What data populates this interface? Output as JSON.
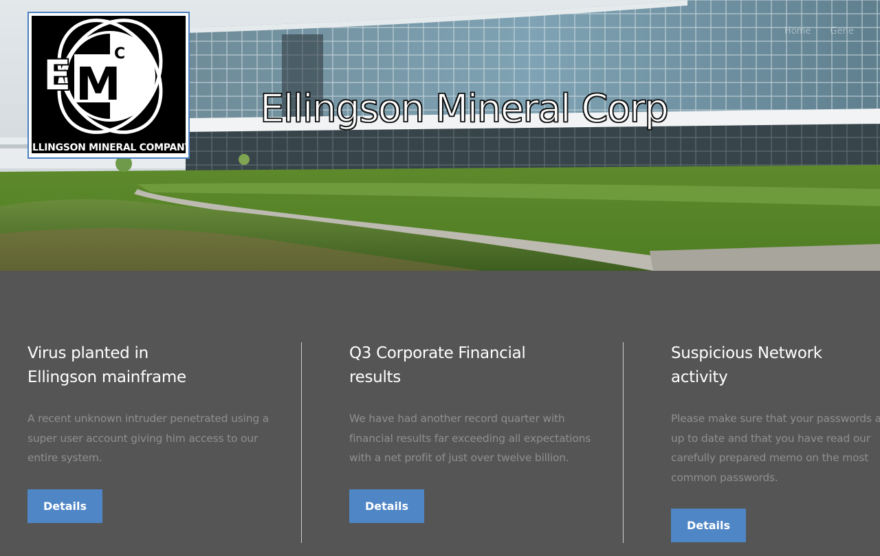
{
  "logo": {
    "letters_e": "E",
    "letters_m": "M",
    "letters_c": "C",
    "company_name": "ELLINGSON MINERAL COMPANY"
  },
  "nav": {
    "items": [
      {
        "label": "Home"
      },
      {
        "label": "Gene"
      }
    ]
  },
  "site_title": "Ellingson Mineral Corp",
  "columns": [
    {
      "title_line1": "Virus planted in",
      "title_line2": "Ellingson mainframe",
      "body": "A recent unknown intruder penetrated using a super user account giving him access to our entire system.",
      "button": "Details"
    },
    {
      "title_line1": "Q3 Corporate Financial",
      "title_line2": "results",
      "body": "We have had another record quarter with financial results far exceeding all expectations with a net profit of just over twelve billion.",
      "button": "Details"
    },
    {
      "title_line1": "Suspicious Network",
      "title_line2": "activity",
      "body": "Please make sure that your passwords are up to date and that you have read our carefully prepared memo on the most common passwords.",
      "button": "Details"
    }
  ],
  "colors": {
    "page_bg": "#555555",
    "accent": "#4f86c6",
    "body_text": "#8f8f8f"
  }
}
